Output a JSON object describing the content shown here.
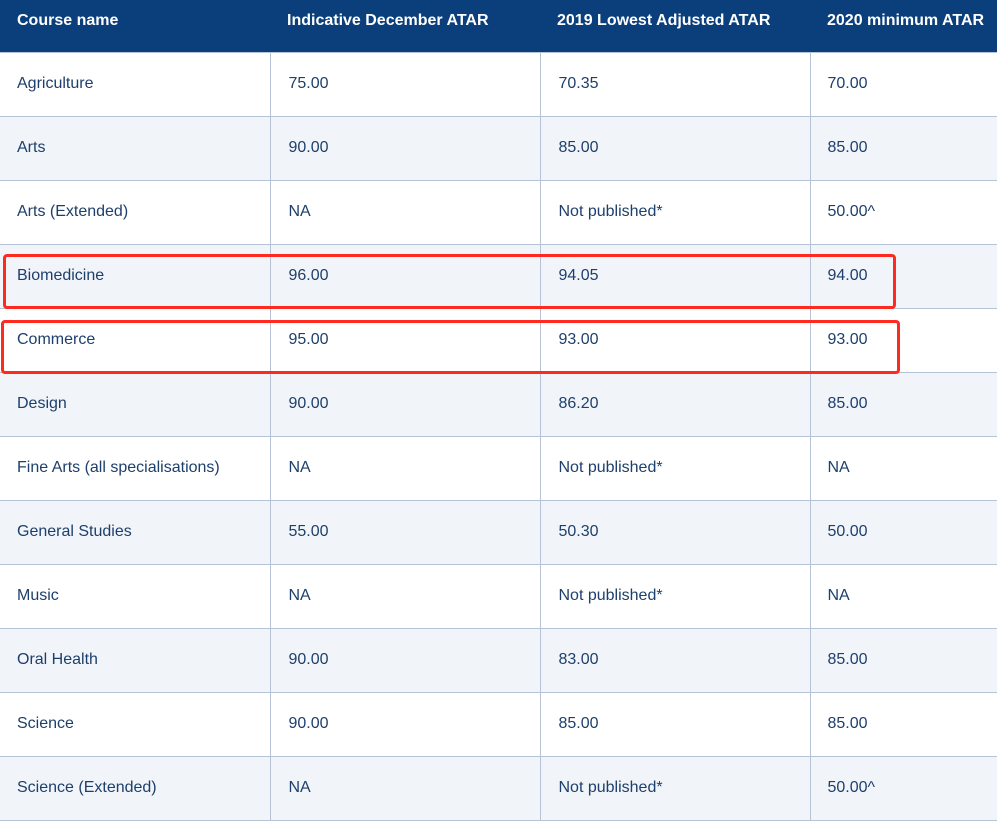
{
  "table": {
    "headers": [
      "Course name",
      "Indicative December ATAR",
      "2019 Lowest Adjusted ATAR",
      "2020 minimum ATAR"
    ],
    "rows": [
      [
        "Agriculture",
        "75.00",
        "70.35",
        "70.00"
      ],
      [
        "Arts",
        "90.00",
        "85.00",
        "85.00"
      ],
      [
        "Arts (Extended)",
        "NA",
        "Not published*",
        "50.00^"
      ],
      [
        "Biomedicine",
        "96.00",
        "94.05",
        "94.00"
      ],
      [
        "Commerce",
        "95.00",
        "93.00",
        "93.00"
      ],
      [
        "Design",
        "90.00",
        "86.20",
        "85.00"
      ],
      [
        "Fine Arts (all specialisations)",
        "NA",
        "Not published*",
        "NA"
      ],
      [
        "General Studies",
        "55.00",
        "50.30",
        "50.00"
      ],
      [
        "Music",
        "NA",
        "Not published*",
        "NA"
      ],
      [
        "Oral Health",
        "90.00",
        "83.00",
        "85.00"
      ],
      [
        "Science",
        "90.00",
        "85.00",
        "85.00"
      ],
      [
        "Science (Extended)",
        "NA",
        "Not published*",
        "50.00^"
      ]
    ]
  },
  "colors": {
    "header_background": "#0b3f7c",
    "header_text": "#ffffff",
    "cell_text": "#1d3f6b",
    "row_alt_background": "#f1f4f9",
    "grid_line": "#b6c3d6",
    "highlight_outline": "#ff2a1f"
  }
}
